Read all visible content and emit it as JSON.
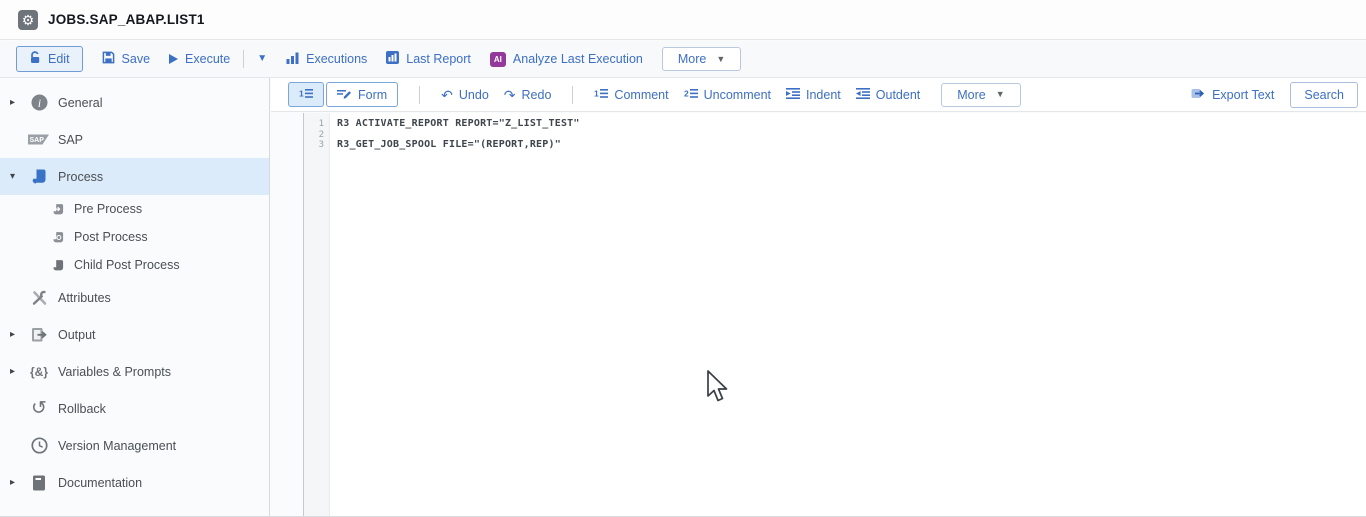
{
  "header": {
    "title": "JOBS.SAP_ABAP.LIST1"
  },
  "main_toolbar": {
    "edit": "Edit",
    "save": "Save",
    "execute": "Execute",
    "executions": "Executions",
    "last_report": "Last Report",
    "analyze": "Analyze Last Execution",
    "ai_badge": "AI",
    "more": "More"
  },
  "editor_toolbar": {
    "form": "Form",
    "undo": "Undo",
    "redo": "Redo",
    "comment": "Comment",
    "uncomment": "Uncomment",
    "indent": "Indent",
    "outdent": "Outdent",
    "more": "More",
    "export_text": "Export Text",
    "search": "Search"
  },
  "sidebar": {
    "variables_glyph": "{&}",
    "items": [
      {
        "label": "General",
        "icon": "info-icon",
        "expandable": true,
        "expanded": false
      },
      {
        "label": "SAP",
        "icon": "sap-icon"
      },
      {
        "label": "Process",
        "icon": "script-icon",
        "expandable": true,
        "expanded": true,
        "selected": true
      },
      {
        "label": "Pre Process",
        "icon": "pre-process-icon",
        "child": true
      },
      {
        "label": "Post Process",
        "icon": "post-process-icon",
        "child": true
      },
      {
        "label": "Child Post Process",
        "icon": "child-post-process-icon",
        "child": true
      },
      {
        "label": "Attributes",
        "icon": "tools-icon"
      },
      {
        "label": "Output",
        "icon": "output-icon",
        "expandable": true,
        "expanded": false
      },
      {
        "label": "Variables & Prompts",
        "icon": "variables-icon",
        "expandable": true,
        "expanded": false
      },
      {
        "label": "Rollback",
        "icon": "rollback-icon"
      },
      {
        "label": "Version Management",
        "icon": "clock-icon"
      },
      {
        "label": "Documentation",
        "icon": "document-icon",
        "expandable": true,
        "expanded": false
      }
    ]
  },
  "editor": {
    "lines": [
      {
        "num": "1",
        "code": "R3 ACTIVATE_REPORT REPORT=\"Z_LIST_TEST\""
      },
      {
        "num": "2",
        "code": ""
      },
      {
        "num": "3",
        "code": "R3_GET_JOB_SPOOL FILE=\"(REPORT,REP)\""
      }
    ]
  },
  "colors": {
    "accent": "#3d6fc4",
    "ai_badge": "#94399c",
    "selected_row": "#dcebf9",
    "selected_button": "#e9f1fb"
  }
}
